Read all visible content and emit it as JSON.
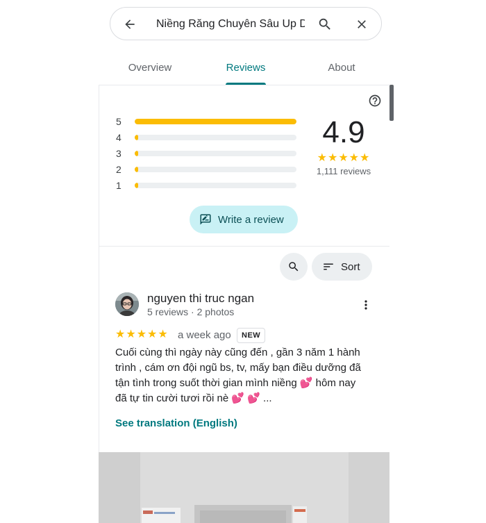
{
  "search": {
    "query": "Niềng Răng Chuyên Sâu Up De"
  },
  "tabs": [
    {
      "label": "Overview",
      "active": false
    },
    {
      "label": "Reviews",
      "active": true
    },
    {
      "label": "About",
      "active": false
    }
  ],
  "ratings": {
    "score": "4.9",
    "stars": "★★★★★",
    "total_reviews": "1,111 reviews",
    "distribution": [
      {
        "stars": "5",
        "fraction": 1.0
      },
      {
        "stars": "4",
        "fraction": 0.01
      },
      {
        "stars": "3",
        "fraction": 0.005
      },
      {
        "stars": "2",
        "fraction": 0.005
      },
      {
        "stars": "1",
        "fraction": 0.02
      }
    ]
  },
  "actions": {
    "write_review_label": "Write a review",
    "sort_label": "Sort"
  },
  "review": {
    "author": "nguyen thi truc ngan",
    "meta": "5 reviews · 2 photos",
    "stars": "★★★★★",
    "time": "a week ago",
    "badge": "NEW",
    "text_lines": [
      "Cuối cùng thì ngày này cũng đến , gần 3 năm 1 hành",
      "trình , cám ơn đội ngũ bs, tv, mấy bạn điều dưỡng đã",
      "tận tình trong suốt thời gian mình niềng 💕  hôm nay",
      "đã tự tin cười tươi rồi nè 💕 💕  ..."
    ],
    "translation_link": "See translation (English)"
  },
  "colors": {
    "accent": "#00797f",
    "star": "#fbbc04",
    "write_button_bg": "#c9f1f5"
  }
}
